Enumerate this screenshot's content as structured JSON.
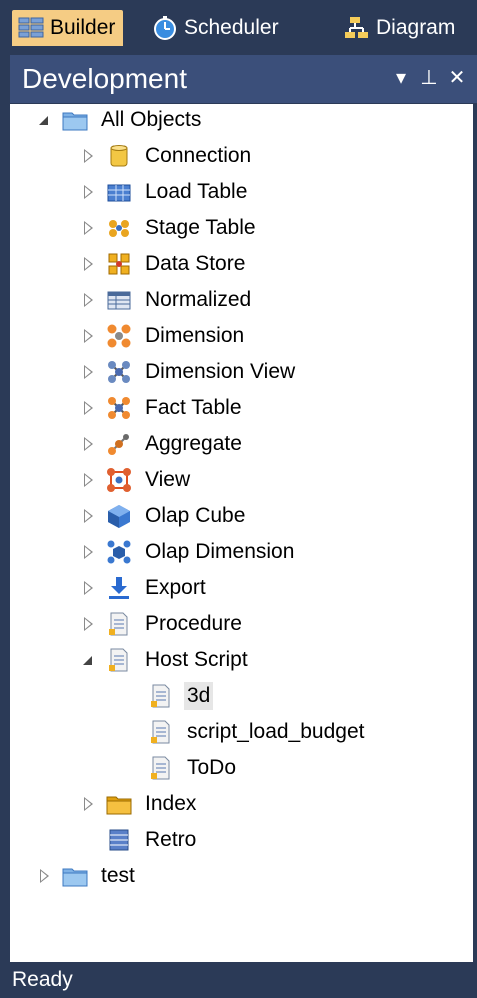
{
  "tabs": [
    {
      "label": "Builder",
      "icon": "grid-icon",
      "active": true
    },
    {
      "label": "Scheduler",
      "icon": "stopwatch-icon",
      "active": false
    },
    {
      "label": "Diagram",
      "icon": "diagram-icon",
      "active": false
    }
  ],
  "panel": {
    "title": "Development",
    "controls": {
      "dropdown": "▾",
      "pin": "⊥",
      "close": "✕"
    }
  },
  "tree": {
    "root": {
      "label": "All Objects",
      "expanded": true,
      "icon": "folder-icon"
    },
    "children": [
      {
        "label": "Connection",
        "icon": "connection-icon",
        "expanded": false
      },
      {
        "label": "Load Table",
        "icon": "load-table-icon",
        "expanded": false
      },
      {
        "label": "Stage Table",
        "icon": "stage-table-icon",
        "expanded": false
      },
      {
        "label": "Data Store",
        "icon": "data-store-icon",
        "expanded": false
      },
      {
        "label": "Normalized",
        "icon": "normalized-icon",
        "expanded": false
      },
      {
        "label": "Dimension",
        "icon": "dimension-icon",
        "expanded": false
      },
      {
        "label": "Dimension View",
        "icon": "dimension-view-icon",
        "expanded": false
      },
      {
        "label": "Fact Table",
        "icon": "fact-table-icon",
        "expanded": false
      },
      {
        "label": "Aggregate",
        "icon": "aggregate-icon",
        "expanded": false
      },
      {
        "label": "View",
        "icon": "view-icon",
        "expanded": false
      },
      {
        "label": "Olap Cube",
        "icon": "olap-cube-icon",
        "expanded": false
      },
      {
        "label": "Olap Dimension",
        "icon": "olap-dimension-icon",
        "expanded": false
      },
      {
        "label": "Export",
        "icon": "export-icon",
        "expanded": false
      },
      {
        "label": "Procedure",
        "icon": "procedure-icon",
        "expanded": false
      },
      {
        "label": "Host Script",
        "icon": "host-script-icon",
        "expanded": true,
        "children": [
          {
            "label": "3d",
            "icon": "script-icon",
            "selected": true
          },
          {
            "label": "script_load_budget",
            "icon": "script-icon",
            "selected": false
          },
          {
            "label": "ToDo",
            "icon": "script-icon",
            "selected": false
          }
        ]
      },
      {
        "label": "Index",
        "icon": "index-icon",
        "expanded": false
      },
      {
        "label": "Retro",
        "icon": "retro-icon",
        "expanded": null
      }
    ],
    "second_root": {
      "label": "test",
      "expanded": false,
      "icon": "folder-icon"
    }
  },
  "status": {
    "text": "Ready"
  }
}
